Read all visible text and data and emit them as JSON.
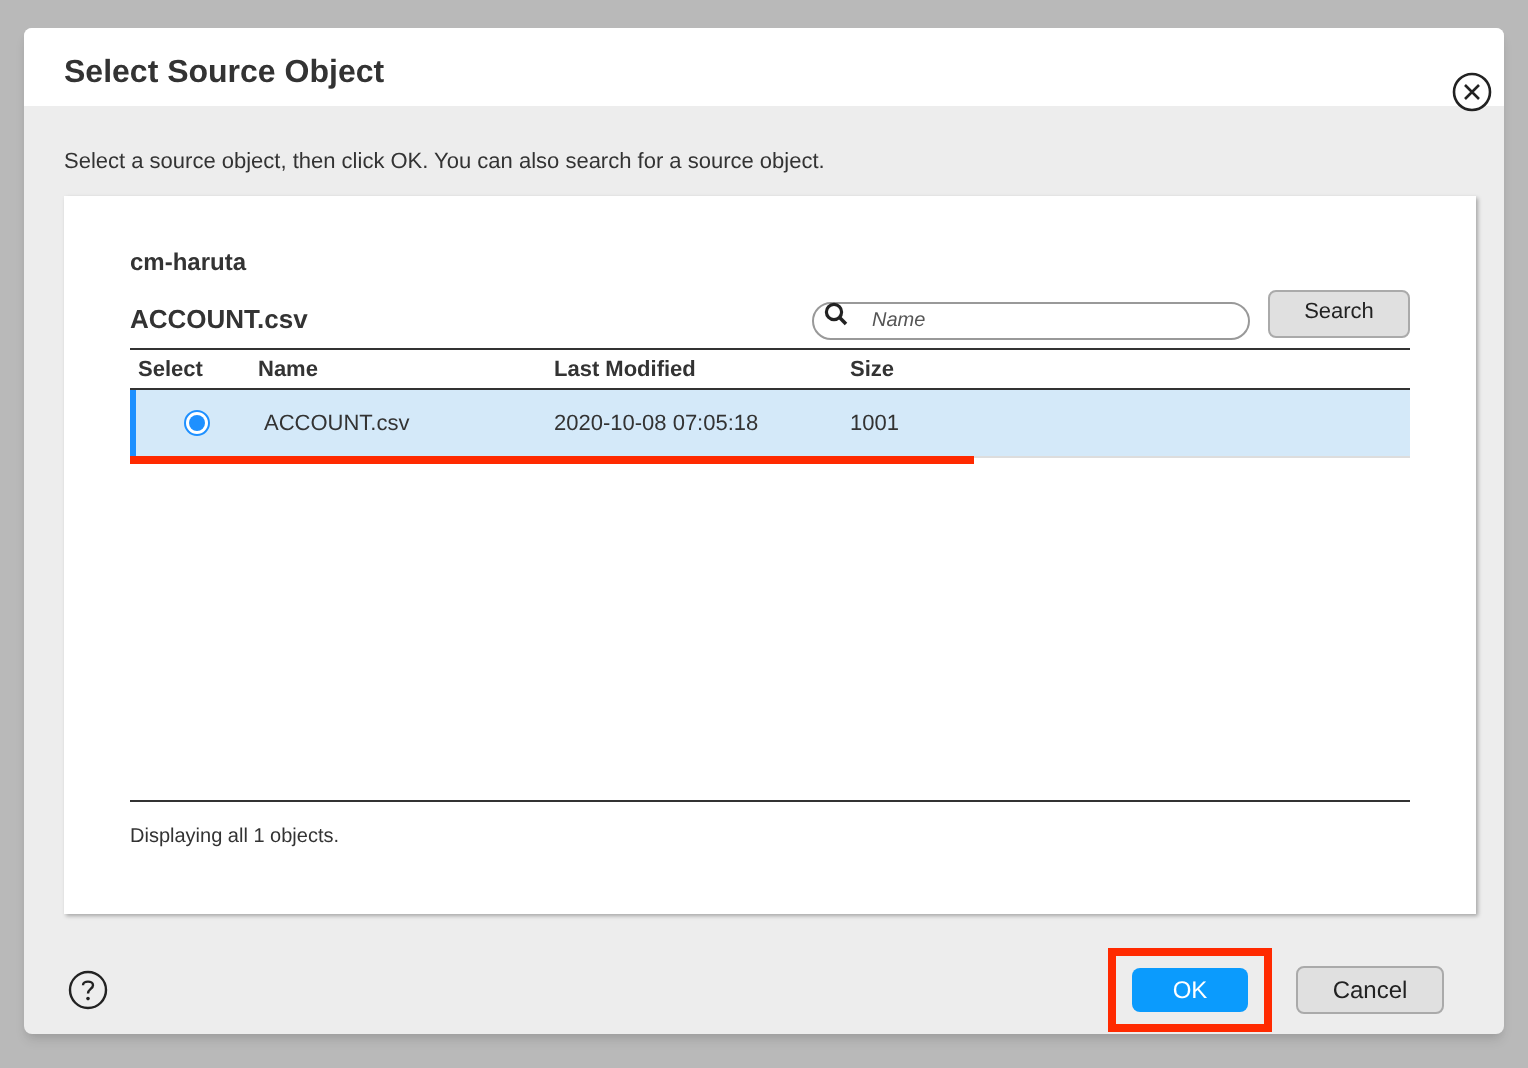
{
  "dialog": {
    "title": "Select Source Object",
    "instruction": "Select a source object, then click OK. You can also search for a source object."
  },
  "panel": {
    "path": "cm-haruta",
    "object": "ACCOUNT.csv",
    "search": {
      "placeholder": "Name"
    },
    "search_button": "Search"
  },
  "table": {
    "columns": [
      "Select",
      "Name",
      "Last Modified",
      "Size"
    ],
    "rows": [
      {
        "selected": true,
        "underlined": true,
        "name": "ACCOUNT.csv",
        "modified": "2020-10-08 07:05:18",
        "size": "1001"
      }
    ]
  },
  "status": "Displaying all 1 objects.",
  "buttons": [
    {
      "label": "OK",
      "kind": "primary",
      "highlighted": true
    },
    {
      "label": "Cancel",
      "kind": "secondary",
      "highlighted": false
    }
  ]
}
